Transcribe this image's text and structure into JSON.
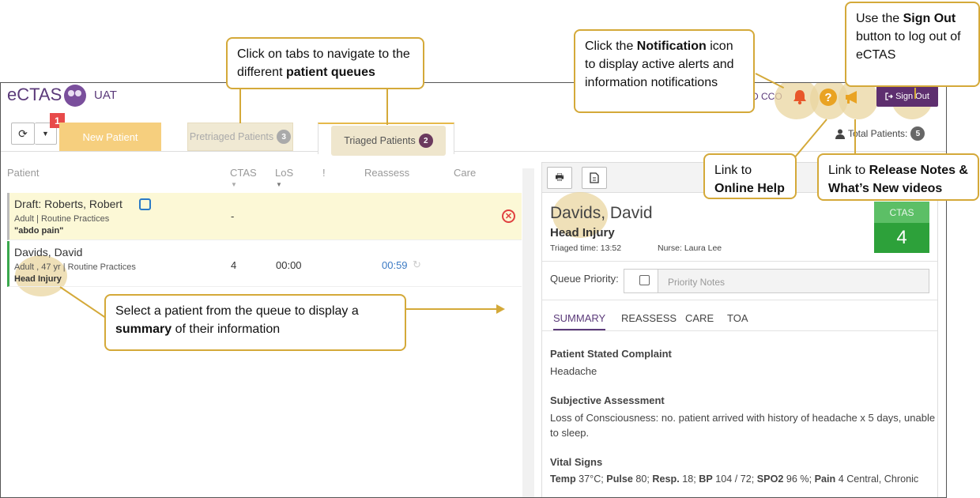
{
  "header": {
    "logo_text": "eCTAS",
    "environment": "UAT",
    "facility": "D CCO",
    "sign_out_label": "Sign Out",
    "icons": [
      "bell-icon",
      "help-icon",
      "megaphone-icon"
    ],
    "brand_color": "#5e2f6f"
  },
  "toolbar": {
    "alert_badge": "1",
    "tabs": [
      {
        "label": "New Patient"
      },
      {
        "label": "Pretriaged Patients",
        "count": "3"
      },
      {
        "label": "Triaged Patients",
        "count": "2",
        "active": true
      }
    ],
    "total_label": "Total Patients:",
    "total_count": "5"
  },
  "queue": {
    "columns": [
      "Patient",
      "CTAS",
      "LoS",
      "!",
      "Reassess",
      "Care"
    ],
    "rows": [
      {
        "name": "Draft: Roberts, Robert",
        "sub": "Adult | Routine Practices",
        "complaint": "\"abdo pain\"",
        "ctas": "-",
        "los": "",
        "reassess": "",
        "status_color": "#bbbbbb"
      },
      {
        "name": "Davids, David",
        "sub": "Adult , 47 yr | Routine Practices",
        "complaint": "Head Injury",
        "ctas": "4",
        "los": "00:00",
        "reassess": "00:59",
        "status_color": "#3aa84d"
      }
    ]
  },
  "summary": {
    "name": "Davids, David",
    "complaint": "Head Injury",
    "triaged_time": "Triaged time: 13:52",
    "nurse": "Nurse: Laura Lee",
    "ctas_label": "CTAS",
    "ctas_value": "4",
    "queue_priority_label": "Queue Priority:",
    "priority_notes_placeholder": "Priority Notes",
    "tabs": [
      "SUMMARY",
      "REASSESS",
      "CARE",
      "TOA"
    ],
    "sections": [
      {
        "heading": "Patient Stated Complaint",
        "text": "Headache"
      },
      {
        "heading": "Subjective Assessment",
        "text": "Loss of Consciousness: no. patient arrived with history of headache x 5 days, unable to sleep."
      },
      {
        "heading": "Vital Signs"
      }
    ],
    "vitals": [
      {
        "label": "Temp",
        "value": "37°C;"
      },
      {
        "label": "Pulse",
        "value": "80;"
      },
      {
        "label": "Resp.",
        "value": "18;"
      },
      {
        "label": "BP",
        "value": "104 / 72;"
      },
      {
        "label": "SPO2",
        "value": "96 %;"
      },
      {
        "label": "Pain",
        "value": "4 Central, Chronic"
      }
    ]
  },
  "callouts": {
    "signout": {
      "a": "Use the ",
      "b": "Sign Out",
      "c": " button to log out of eCTAS"
    },
    "notification": {
      "a": "Click the ",
      "b": "Notification",
      "c": " icon to display active alerts and information notifications"
    },
    "tabs": {
      "a": "Click on tabs to navigate to the different ",
      "b": "patient queues",
      "c": ""
    },
    "help": {
      "a": "Link to ",
      "b": "Online Help",
      "c": ""
    },
    "release": {
      "a": "Link to ",
      "b": "Release Notes & What’s New videos",
      "c": ""
    },
    "select": {
      "a": "Select a patient from the queue to display a ",
      "b": "summary",
      "c": " of their information"
    }
  }
}
